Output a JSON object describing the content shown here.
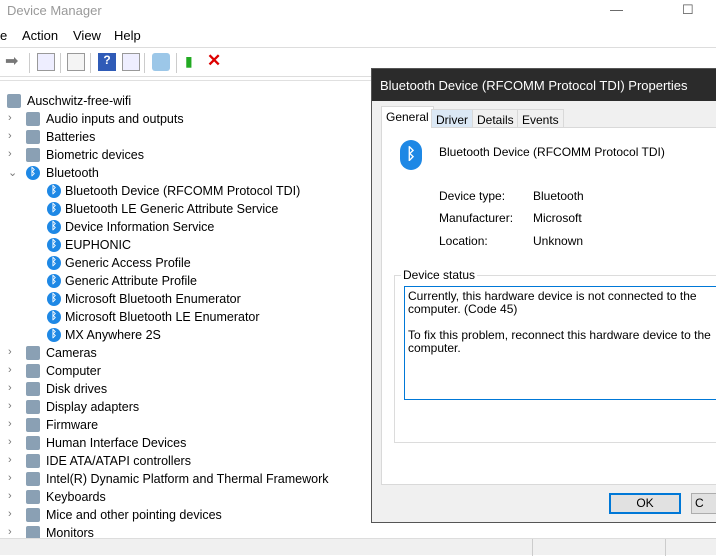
{
  "window": {
    "title": "Device Manager",
    "minimize": "—",
    "maximize": "☐"
  },
  "menu": [
    "e",
    "Action",
    "View",
    "Help"
  ],
  "tree": {
    "root": "Auschwitz-free-wifi",
    "before": [
      "Audio inputs and outputs",
      "Batteries",
      "Biometric devices"
    ],
    "bluetooth": "Bluetooth",
    "bt_children": [
      "Bluetooth Device (RFCOMM Protocol TDI)",
      "Bluetooth LE Generic Attribute Service",
      "Device Information Service",
      "EUPHONIC",
      "Generic Access Profile",
      "Generic Attribute Profile",
      "Microsoft Bluetooth Enumerator",
      "Microsoft Bluetooth LE Enumerator",
      "MX Anywhere 2S"
    ],
    "after": [
      "Cameras",
      "Computer",
      "Disk drives",
      "Display adapters",
      "Firmware",
      "Human Interface Devices",
      "IDE ATA/ATAPI controllers",
      "Intel(R) Dynamic Platform and Thermal Framework",
      "Keyboards",
      "Mice and other pointing devices",
      "Monitors"
    ]
  },
  "dialog": {
    "title": "Bluetooth Device (RFCOMM Protocol TDI) Properties",
    "tabs": [
      "General",
      "Driver",
      "Details",
      "Events"
    ],
    "device_name": "Bluetooth Device (RFCOMM Protocol TDI)",
    "props": [
      {
        "label": "Device type:",
        "value": "Bluetooth"
      },
      {
        "label": "Manufacturer:",
        "value": "Microsoft"
      },
      {
        "label": "Location:",
        "value": "Unknown"
      }
    ],
    "status_label": "Device status",
    "status_line1": "Currently, this hardware device is not connected to the computer. (Code 45)",
    "status_line2": "To fix this problem, reconnect this hardware device to the computer.",
    "ok": "OK",
    "cancel": "C"
  }
}
